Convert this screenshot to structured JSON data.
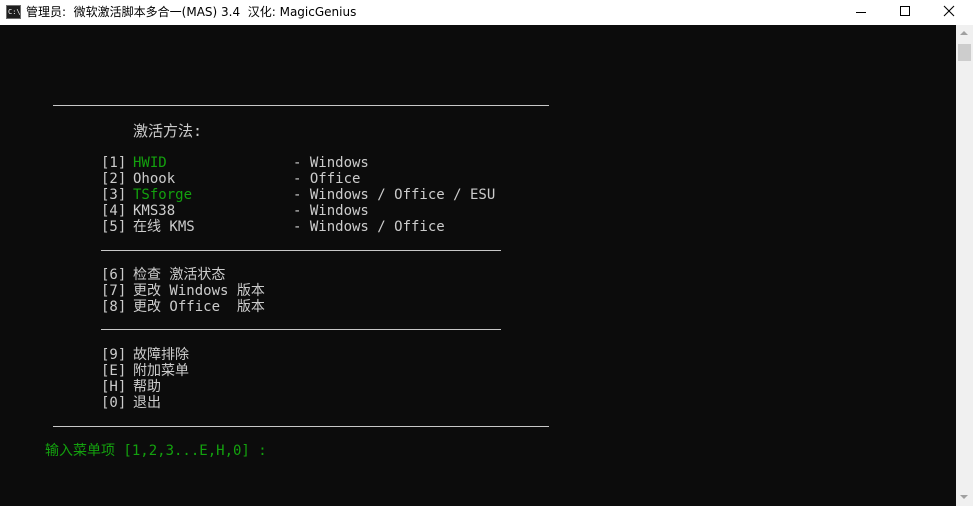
{
  "window": {
    "title": "管理员:  微软激活脚本多合一(MAS) 3.4  汉化: MagicGenius",
    "icon": "console-app-icon",
    "icon_text": "C:\\"
  },
  "controls": {
    "minimize_icon": "minimize-icon",
    "maximize_icon": "maximize-icon",
    "close_icon": "close-icon"
  },
  "console": {
    "heading": "激活方法:",
    "methods": [
      {
        "key": "[1]",
        "name": "HWID",
        "desc": "- Windows",
        "color": "#13a10e"
      },
      {
        "key": "[2]",
        "name": "Ohook",
        "desc": "- Office",
        "color": "#cccccc"
      },
      {
        "key": "[3]",
        "name": "TSforge",
        "desc": "- Windows / Office / ESU",
        "color": "#13a10e"
      },
      {
        "key": "[4]",
        "name": "KMS38",
        "desc": "- Windows",
        "color": "#cccccc"
      },
      {
        "key": "[5]",
        "name": "在线 KMS",
        "desc": "- Windows / Office",
        "color": "#cccccc"
      }
    ],
    "tools": [
      {
        "key": "[6]",
        "label": "检查 激活状态"
      },
      {
        "key": "[7]",
        "label": "更改 Windows 版本"
      },
      {
        "key": "[8]",
        "label": "更改 Office  版本"
      }
    ],
    "misc": [
      {
        "key": "[9]",
        "label": "故障排除"
      },
      {
        "key": "[E]",
        "label": "附加菜单"
      },
      {
        "key": "[H]",
        "label": "帮助"
      },
      {
        "key": "[0]",
        "label": "退出"
      }
    ],
    "prompt": "输入菜单项 [1,2,3...E,H,0] :",
    "accent_color": "#13a10e",
    "text_color": "#cccccc",
    "background": "#0c0c0c"
  }
}
